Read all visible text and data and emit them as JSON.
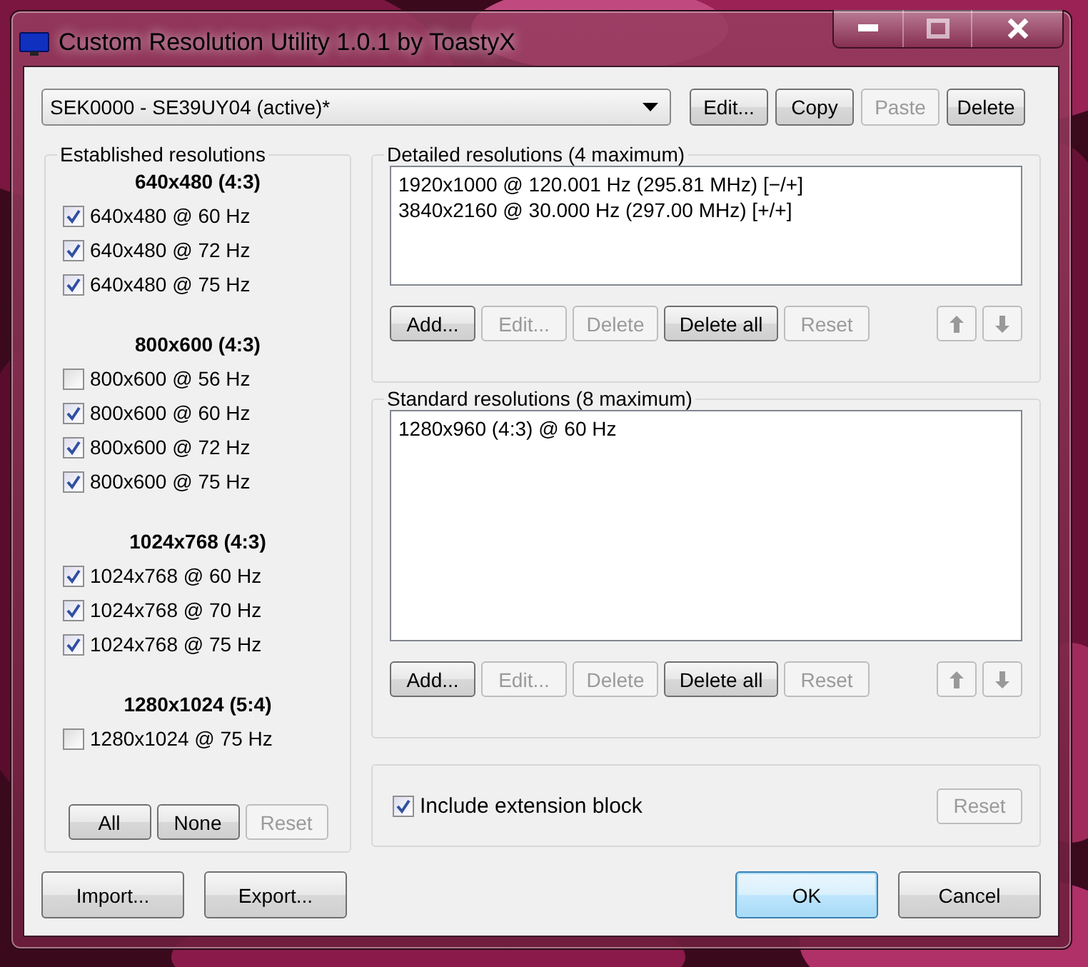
{
  "window": {
    "title": "Custom Resolution Utility 1.0.1 by ToastyX"
  },
  "monitor_select": {
    "value": "SEK0000 - SE39UY04 (active)*"
  },
  "top_buttons": [
    {
      "label": "Edit...",
      "disabled": false
    },
    {
      "label": "Copy",
      "disabled": false
    },
    {
      "label": "Paste",
      "disabled": true
    },
    {
      "label": "Delete",
      "disabled": false
    }
  ],
  "established": {
    "title": "Established resolutions",
    "groups": [
      {
        "heading": "640x480 (4:3)",
        "items": [
          {
            "label": "640x480 @ 60 Hz",
            "checked": true
          },
          {
            "label": "640x480 @ 72 Hz",
            "checked": true
          },
          {
            "label": "640x480 @ 75 Hz",
            "checked": true
          }
        ]
      },
      {
        "heading": "800x600 (4:3)",
        "items": [
          {
            "label": "800x600 @ 56 Hz",
            "checked": false
          },
          {
            "label": "800x600 @ 60 Hz",
            "checked": true
          },
          {
            "label": "800x600 @ 72 Hz",
            "checked": true
          },
          {
            "label": "800x600 @ 75 Hz",
            "checked": true
          }
        ]
      },
      {
        "heading": "1024x768 (4:3)",
        "items": [
          {
            "label": "1024x768 @ 60 Hz",
            "checked": true
          },
          {
            "label": "1024x768 @ 70 Hz",
            "checked": true
          },
          {
            "label": "1024x768 @ 75 Hz",
            "checked": true
          }
        ]
      },
      {
        "heading": "1280x1024 (5:4)",
        "items": [
          {
            "label": "1280x1024 @ 75 Hz",
            "checked": false
          }
        ]
      }
    ],
    "buttons": [
      {
        "label": "All",
        "disabled": false
      },
      {
        "label": "None",
        "disabled": false
      },
      {
        "label": "Reset",
        "disabled": true
      }
    ]
  },
  "lists": [
    {
      "title": "Detailed resolutions (4 maximum)",
      "items": [
        "1920x1000 @ 120.001 Hz (295.81 MHz) [−/+]",
        "3840x2160 @ 30.000 Hz (297.00 MHz) [+/+]"
      ],
      "buttons": [
        {
          "label": "Add...",
          "disabled": false
        },
        {
          "label": "Edit...",
          "disabled": true
        },
        {
          "label": "Delete",
          "disabled": true
        },
        {
          "label": "Delete all",
          "disabled": false
        },
        {
          "label": "Reset",
          "disabled": true
        }
      ],
      "arrows": [
        {
          "kind": "up",
          "disabled": true
        },
        {
          "kind": "down",
          "disabled": true
        }
      ]
    },
    {
      "title": "Standard resolutions (8 maximum)",
      "items": [
        "1280x960 (4:3) @ 60 Hz"
      ],
      "buttons": [
        {
          "label": "Add...",
          "disabled": false
        },
        {
          "label": "Edit...",
          "disabled": true
        },
        {
          "label": "Delete",
          "disabled": true
        },
        {
          "label": "Delete all",
          "disabled": false
        },
        {
          "label": "Reset",
          "disabled": true
        }
      ],
      "arrows": [
        {
          "kind": "up",
          "disabled": true
        },
        {
          "kind": "down",
          "disabled": true
        }
      ]
    }
  ],
  "extension": {
    "label": "Include extension block",
    "checked": true,
    "reset": {
      "label": "Reset",
      "disabled": true
    }
  },
  "bottom_left": [
    {
      "label": "Import...",
      "disabled": false,
      "default": false
    },
    {
      "label": "Export...",
      "disabled": false,
      "default": false
    }
  ],
  "bottom_right": [
    {
      "label": "OK",
      "disabled": false,
      "default": true
    },
    {
      "label": "Cancel",
      "disabled": false,
      "default": false
    }
  ]
}
